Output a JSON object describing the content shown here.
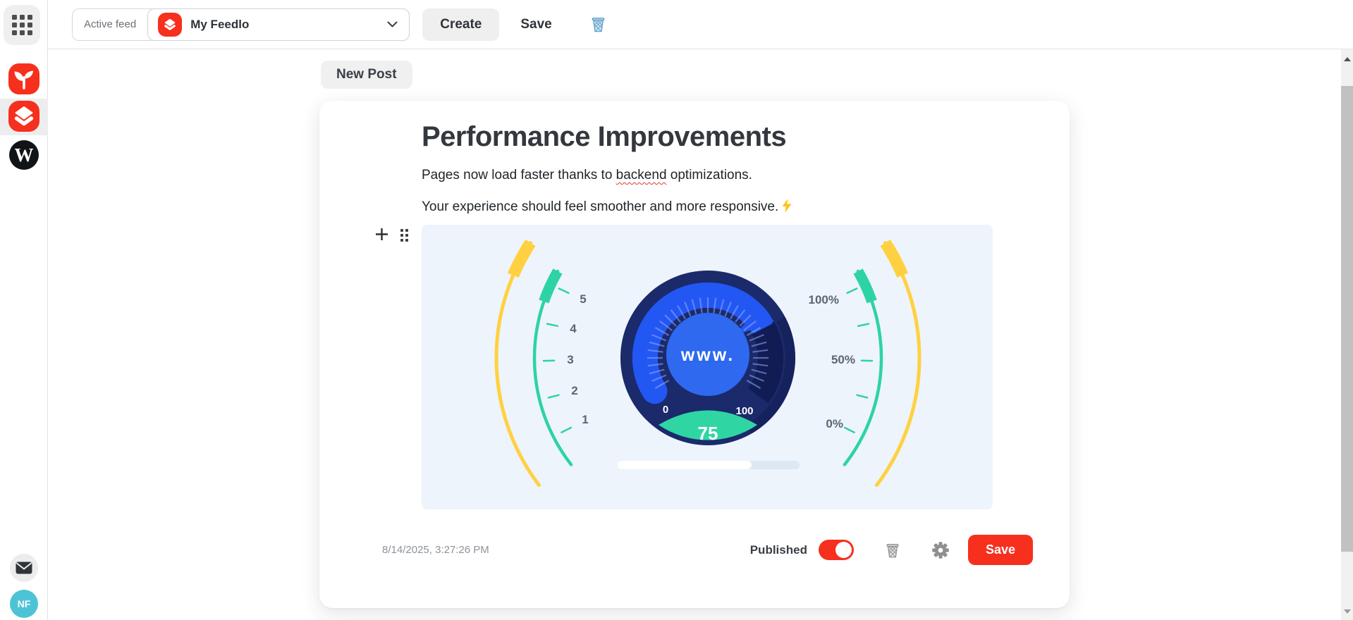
{
  "toolbar": {
    "active_feed_label": "Active feed",
    "feed_name": "My Feedlo",
    "create_label": "Create",
    "save_label": "Save"
  },
  "sidebar": {
    "wordpress_letter": "W",
    "avatar_initials": "NF"
  },
  "content": {
    "new_post_label": "New Post"
  },
  "post": {
    "title": "Performance Improvements",
    "body1_pre": "Pages now load faster thanks to ",
    "body1_word": "backend",
    "body1_post": " optimizations.",
    "body2": "Your experience should feel smoother and more responsive.",
    "timestamp": "8/14/2025, 3:27:26 PM",
    "published_label": "Published",
    "save_label": "Save"
  },
  "illustration": {
    "type": "speedometer-gauge",
    "center_label": "www.",
    "scale_start": "0",
    "scale_end": "100",
    "value": "75",
    "left_scale": [
      "5",
      "4",
      "3",
      "2",
      "1"
    ],
    "right_scale": [
      "100%",
      "50%",
      "0%"
    ]
  },
  "colors": {
    "accent_red": "#f6301d",
    "teal": "#2ed3a3",
    "yellow": "#ffd140",
    "navy": "#1b2a6b",
    "band_blue": "#2257f4",
    "inner_blue": "#2e69f0",
    "avatar_cyan": "#4dc4d6",
    "illustration_bg": "#edf4fb"
  }
}
